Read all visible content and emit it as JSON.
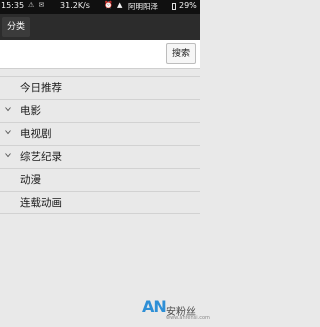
{
  "status_bar": {
    "time": "15:35",
    "icons_left": "⚠ ✉",
    "net_speed": "31.2K/s",
    "icons_mid": "⏰ ▲",
    "carrier": "阿明阳泽",
    "battery": "29%"
  },
  "header": {
    "tab_label": "分类"
  },
  "search": {
    "placeholder": "",
    "value": "",
    "button_label": "搜索"
  },
  "categories": [
    {
      "label": "今日推荐",
      "expandable": false
    },
    {
      "label": "电影",
      "expandable": true
    },
    {
      "label": "电视剧",
      "expandable": true
    },
    {
      "label": "综艺纪录",
      "expandable": true
    },
    {
      "label": "动漫",
      "expandable": false
    },
    {
      "label": "连载动画",
      "expandable": false
    }
  ],
  "watermark": {
    "logo": "AN",
    "text": "安粉丝",
    "domain": "www.anfensi.com"
  },
  "colors": {
    "status_bar_bg": "#101010",
    "title_bar_bg": "#2c2c2c",
    "list_bg": "#e9e9e9",
    "divider": "#d2d2d2",
    "watermark_blue": "#2e8fd6"
  }
}
